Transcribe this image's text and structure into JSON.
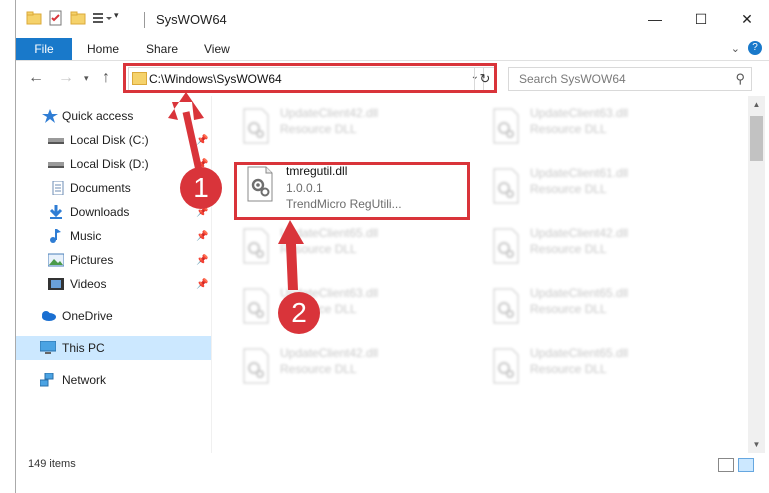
{
  "window": {
    "title": "SysWOW64",
    "controls": {
      "minimize": "—",
      "maximize": "☐",
      "close": "✕"
    }
  },
  "ribbon": {
    "file_tab": "File",
    "tabs": [
      "Home",
      "Share",
      "View"
    ],
    "help": "?"
  },
  "nav": {
    "address": "C:\\Windows\\SysWOW64",
    "search_placeholder": "Search SysWOW64"
  },
  "sidebar": {
    "items": [
      {
        "label": "Quick access",
        "icon": "star-icon",
        "pinned": false
      },
      {
        "label": "Local Disk (C:)",
        "icon": "drive-icon",
        "pinned": true
      },
      {
        "label": "Local Disk (D:)",
        "icon": "drive-icon",
        "pinned": true
      },
      {
        "label": "Documents",
        "icon": "documents-icon",
        "pinned": true
      },
      {
        "label": "Downloads",
        "icon": "downloads-icon",
        "pinned": true
      },
      {
        "label": "Music",
        "icon": "music-icon",
        "pinned": true
      },
      {
        "label": "Pictures",
        "icon": "pictures-icon",
        "pinned": true
      },
      {
        "label": "Videos",
        "icon": "videos-icon",
        "pinned": true
      },
      {
        "label": "OneDrive",
        "icon": "onedrive-icon",
        "pinned": false
      },
      {
        "label": "This PC",
        "icon": "pc-icon",
        "pinned": false,
        "selected": true
      },
      {
        "label": "Network",
        "icon": "network-icon",
        "pinned": false
      }
    ]
  },
  "files": [
    {
      "name": "UpdateClient42.dll",
      "line2": "Resource DLL",
      "line3": "",
      "blurred": true
    },
    {
      "name": "UpdateClient63.dll",
      "line2": "Resource DLL",
      "line3": "",
      "blurred": true
    },
    {
      "name": "tmregutil.dll",
      "line2": "1.0.0.1",
      "line3": "TrendMicro RegUtili...",
      "blurred": false
    },
    {
      "name": "UpdateClient61.dll",
      "line2": "Resource DLL",
      "line3": "",
      "blurred": true
    },
    {
      "name": "UpdateClient65.dll",
      "line2": "Resource DLL",
      "line3": "",
      "blurred": true
    },
    {
      "name": "UpdateClient42.dll",
      "line2": "Resource DLL",
      "line3": "",
      "blurred": true
    },
    {
      "name": "UpdateClient63.dll",
      "line2": "Resource DLL",
      "line3": "",
      "blurred": true
    },
    {
      "name": "UpdateClient65.dll",
      "line2": "Resource DLL",
      "line3": "",
      "blurred": true
    },
    {
      "name": "UpdateClient42.dll",
      "line2": "Resource DLL",
      "line3": "",
      "blurred": true
    },
    {
      "name": "UpdateClient65.dll",
      "line2": "Resource DLL",
      "line3": "",
      "blurred": true
    }
  ],
  "status": {
    "item_count": "149 items"
  },
  "annotations": {
    "step1": "1",
    "step2": "2",
    "color": "#d9343a"
  }
}
